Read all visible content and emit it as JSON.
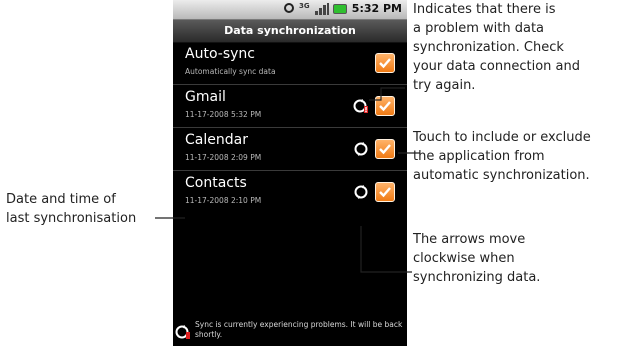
{
  "status_bar": {
    "time": "5:32 PM",
    "network_label": "3G"
  },
  "screen_title": "Data synchronization",
  "rows": [
    {
      "title": "Auto-sync",
      "subtitle": "Automatically sync data",
      "checked": true,
      "sync_state": "none"
    },
    {
      "title": "Gmail",
      "subtitle": "11-17-2008 5:32 PM",
      "checked": true,
      "sync_state": "error"
    },
    {
      "title": "Calendar",
      "subtitle": "11-17-2008 2:09 PM",
      "checked": true,
      "sync_state": "idle"
    },
    {
      "title": "Contacts",
      "subtitle": "11-17-2008 2:10 PM",
      "checked": true,
      "sync_state": "idle"
    }
  ],
  "footer_message": "Sync is currently experiencing problems. It will be back shortly.",
  "callouts": {
    "error_icon": "Indicates that there is\na problem with data\nsynchronization. Check\nyour data connection and\ntry again.",
    "checkbox": "Touch to include or exclude\nthe application from\nautomatic synchronization.",
    "arrows": "The arrows move\nclockwise when\nsynchronizing data.",
    "timestamp": "Date and time of\nlast synchronisation"
  },
  "colors": {
    "checkbox": "#f07a14",
    "screen_bg": "#000000",
    "error_badge": "#e02020"
  }
}
